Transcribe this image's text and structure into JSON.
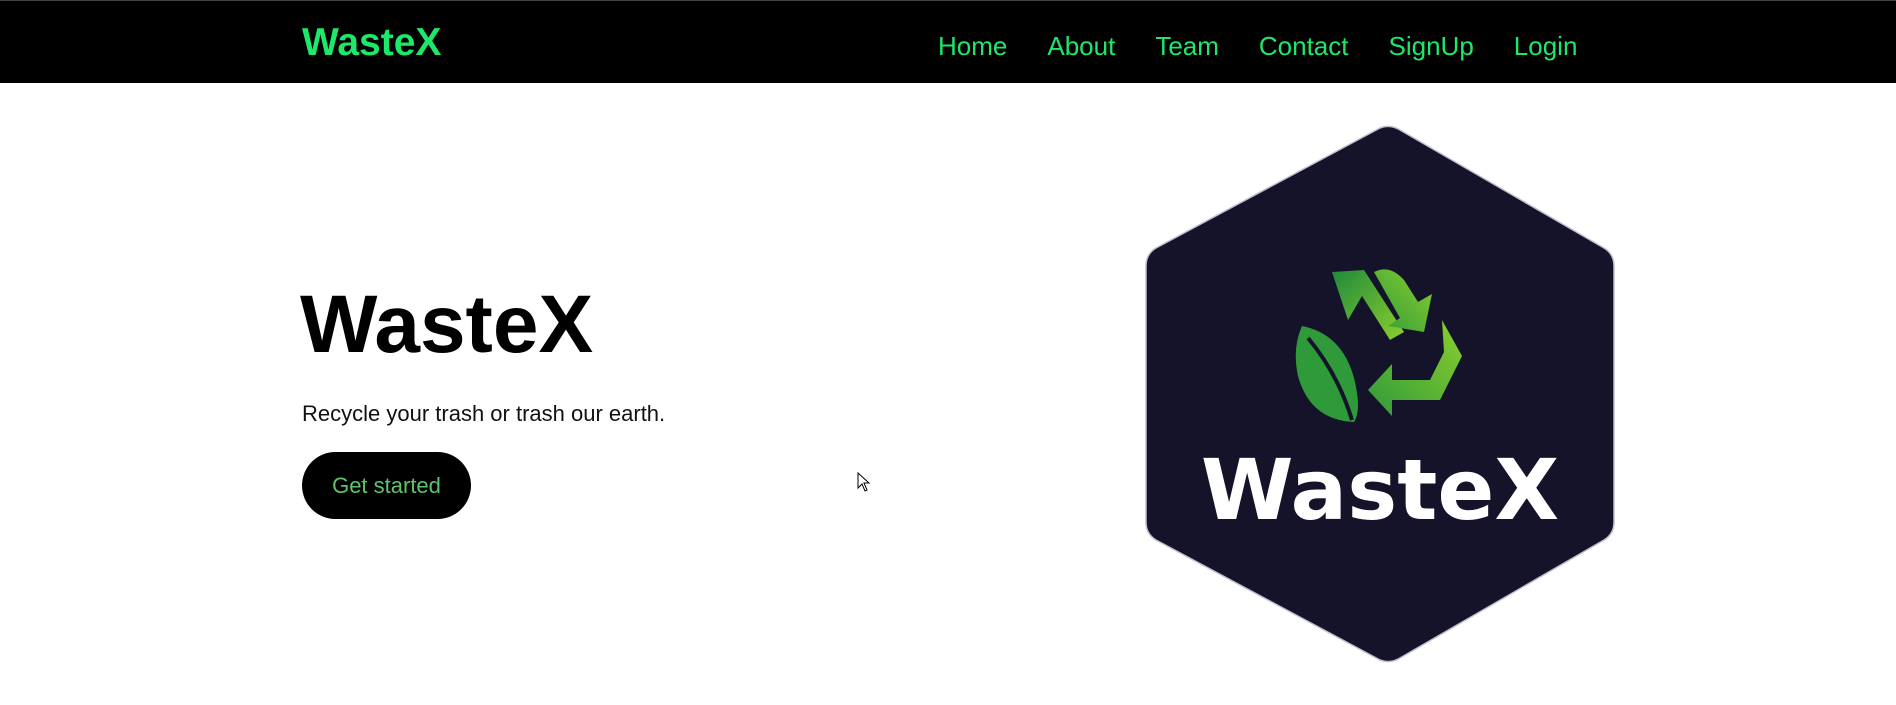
{
  "nav": {
    "brand": "WasteX",
    "links": [
      "Home",
      "About",
      "Team",
      "Contact",
      "SignUp",
      "Login"
    ]
  },
  "hero": {
    "title": "WasteX",
    "tagline": "Recycle your trash or trash our earth.",
    "cta_label": "Get started"
  },
  "logo": {
    "wordmark": "WasteX",
    "icon": "recycle-leaf-icon"
  },
  "colors": {
    "brand_green": "#1de86a",
    "cta_text": "#5cc46a",
    "logo_bg": "#15132a",
    "recycle_green_dark": "#2f9a3a",
    "recycle_green_light": "#8ccf2e"
  }
}
